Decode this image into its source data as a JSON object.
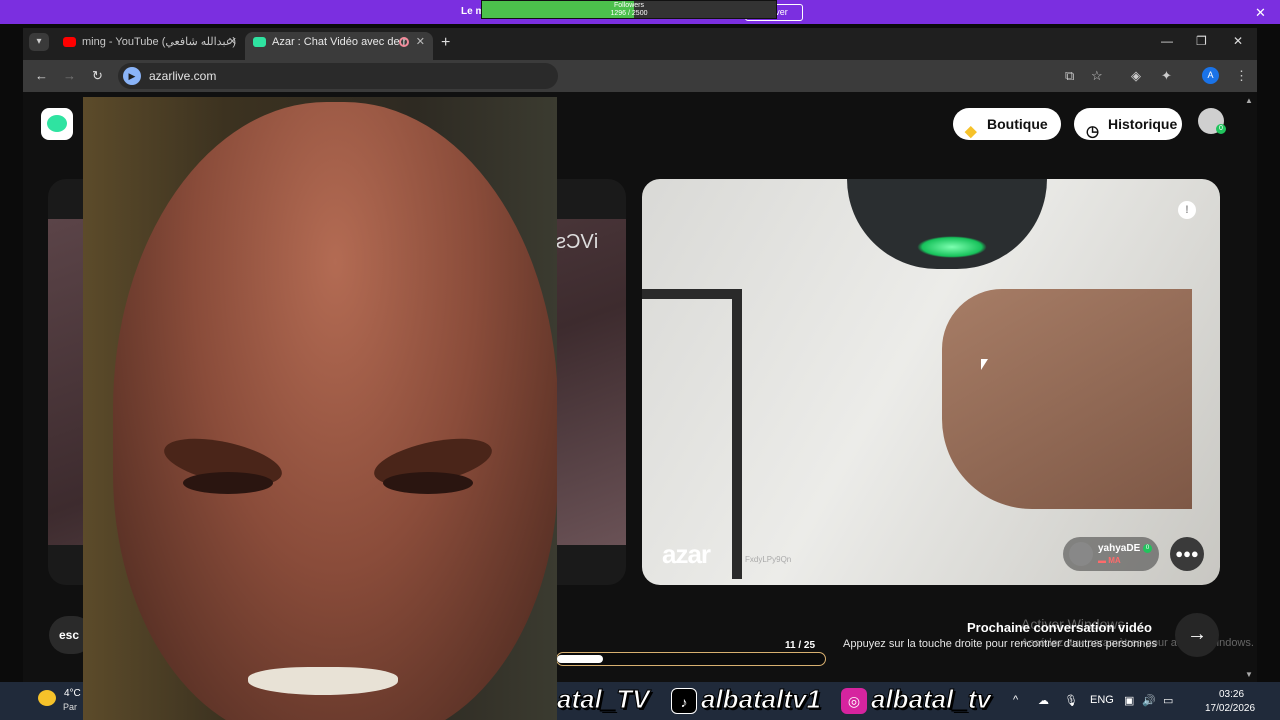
{
  "promo": {
    "text": "Le m",
    "button_label": "Activer",
    "close_glyph": "✕",
    "followers_label": "Followers",
    "followers_current": 1296,
    "followers_goal": 2500,
    "followers_count_text": "1296 / 2500"
  },
  "browser": {
    "tabs": [
      {
        "title": "ming - YouTube (عبدالله شافعي)",
        "icon": "youtube-icon",
        "icon_color": "#ff0000"
      },
      {
        "title": "Azar : Chat Vidéo avec de n",
        "icon": "azar-icon",
        "icon_color": "#2fe3a1"
      }
    ],
    "url": "azarlive.com",
    "profile_initial": "A"
  },
  "azar": {
    "shop_label": "Boutique",
    "history_label": "Historique",
    "avatar_badge": "0",
    "left_card_text": "iVCs",
    "watermark": "azar",
    "watermark_id": "FxdyLPy9Qn",
    "peer_name": "yahyaDE",
    "peer_badge": "0",
    "peer_country": "MA",
    "esc_label": "esc",
    "next_title": "Prochaine conversation vidéo",
    "next_subtitle": "Appuyez sur la touche droite pour rencontrer d'autres personnes",
    "activation_title": "Activer Windows",
    "activation_subtitle": "Accédez aux paramètres pour activer Windows.",
    "progress_current": "11",
    "progress_total": "/ 25",
    "progress_fraction": 0.17
  },
  "overlay": {
    "tiktok_handle": "albataltv1",
    "instagram_handle": "albatal_tv",
    "partial_handle": "atal_TV"
  },
  "taskbar": {
    "temp": "4°C",
    "weather_sub": "Par",
    "language": "ENG",
    "time": "03:26",
    "date": "17/02/2026"
  },
  "colors": {
    "promo_bg": "#7b2fe0",
    "accent_green": "#2fe3a1",
    "progress_border": "#d8b070"
  }
}
